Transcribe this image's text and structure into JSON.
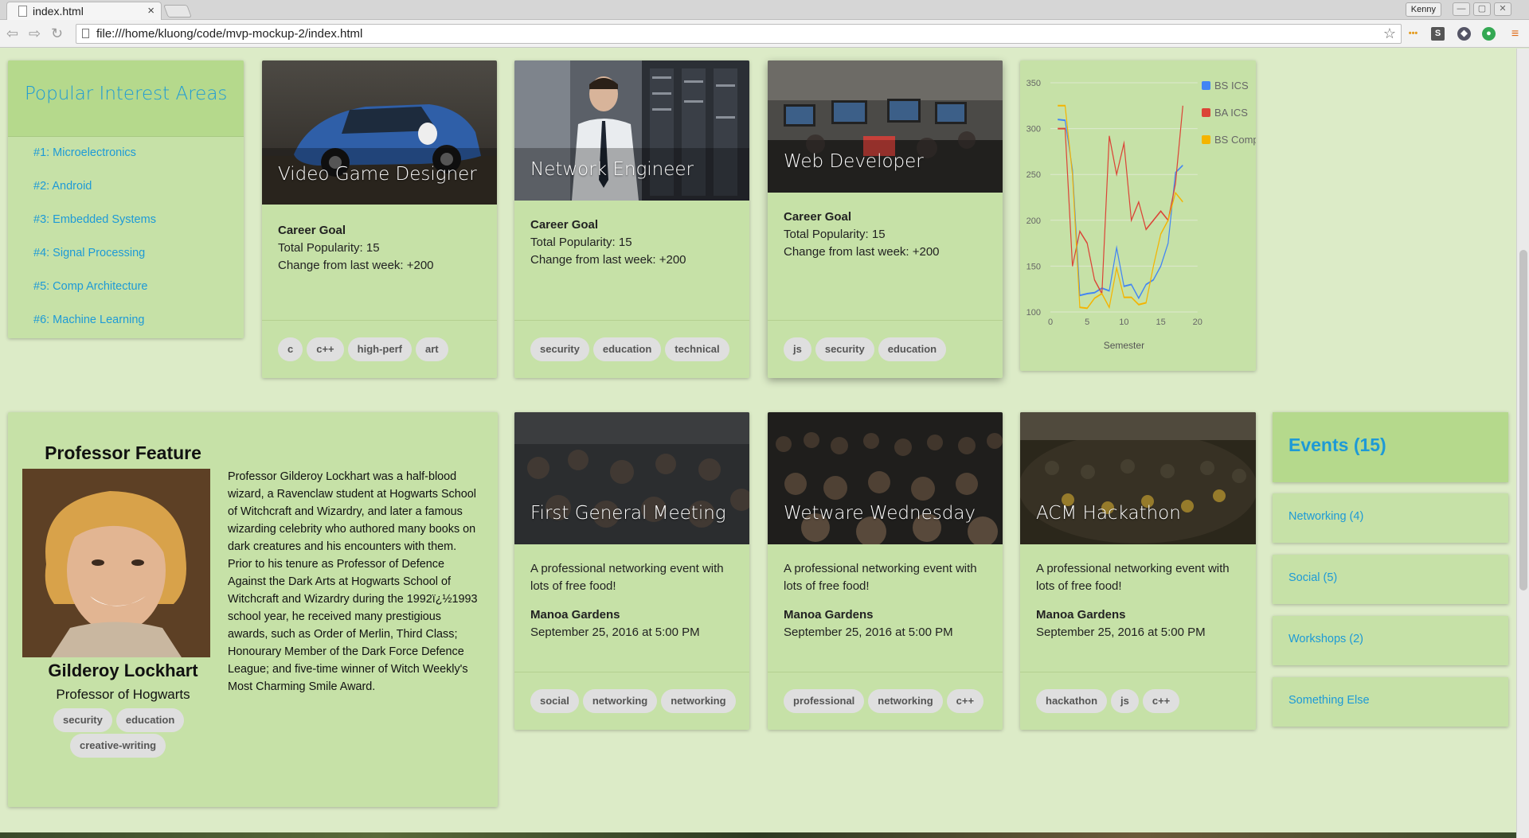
{
  "browser": {
    "tab_title": "index.html",
    "tab_close": "×",
    "user_badge": "Kenny",
    "url": "file:///home/kluong/code/mvp-mockup-2/index.html",
    "min": "—",
    "max": "▢",
    "close": "✕"
  },
  "interests": {
    "title": "Popular Interest Areas",
    "items": [
      "#1: Microelectronics",
      "#2: Android",
      "#3: Embedded Systems",
      "#4: Signal Processing",
      "#5: Comp Architecture",
      "#6: Machine Learning"
    ]
  },
  "careers": [
    {
      "title": "Video Game Designer",
      "goal": "Career Goal",
      "popularity": "Total Popularity: 15",
      "change": "Change from last week: +200",
      "tags": [
        "c",
        "c++",
        "high-perf",
        "art"
      ]
    },
    {
      "title": "Network Engineer",
      "goal": "Career Goal",
      "popularity": "Total Popularity: 15",
      "change": "Change from last week: +200",
      "tags": [
        "security",
        "education",
        "technical"
      ]
    },
    {
      "title": "Web Developer",
      "goal": "Career Goal",
      "popularity": "Total Popularity: 15",
      "change": "Change from last week: +200",
      "tags": [
        "js",
        "security",
        "education"
      ]
    }
  ],
  "chart_data": {
    "type": "line",
    "xlabel": "Semester",
    "ylabel": "",
    "xlim": [
      0,
      20
    ],
    "ylim": [
      100,
      350
    ],
    "x_ticks": [
      0,
      5,
      10,
      15,
      20
    ],
    "y_ticks": [
      100,
      150,
      200,
      250,
      300,
      350
    ],
    "grid": true,
    "legend_position": "top-right",
    "series": [
      {
        "name": "BS ICS",
        "color": "#4285f4",
        "x": [
          1,
          2,
          3,
          4,
          5,
          6,
          7,
          8,
          9,
          10,
          11,
          12,
          13,
          14,
          15,
          16,
          17,
          18
        ],
        "values": [
          310,
          309,
          255,
          118,
          120,
          121,
          126,
          123,
          170,
          128,
          130,
          115,
          130,
          135,
          150,
          175,
          252,
          260
        ]
      },
      {
        "name": "BA ICS",
        "color": "#db4437",
        "x": [
          1,
          2,
          3,
          4,
          5,
          6,
          7,
          8,
          9,
          10,
          11,
          12,
          13,
          14,
          15,
          16,
          17,
          18
        ],
        "values": [
          300,
          300,
          150,
          188,
          175,
          135,
          120,
          292,
          250,
          284,
          200,
          220,
          190,
          200,
          210,
          200,
          240,
          325
        ]
      },
      {
        "name": "BS CompE",
        "color": "#f4b400",
        "x": [
          1,
          2,
          3,
          4,
          5,
          6,
          7,
          8,
          9,
          10,
          11,
          12,
          13,
          14,
          15,
          16,
          17,
          18
        ],
        "values": [
          325,
          325,
          250,
          105,
          104,
          115,
          120,
          105,
          148,
          116,
          116,
          108,
          110,
          150,
          185,
          200,
          230,
          220
        ]
      }
    ]
  },
  "professor": {
    "section_title": "Professor Feature",
    "name": "Gilderoy Lockhart",
    "role": "Professor of Hogwarts",
    "tags": [
      "security",
      "education",
      "creative-writing"
    ],
    "bio1": "Professor Gilderoy Lockhart was a half-blood wizard, a Ravenclaw student at Hogwarts School of Witchcraft and Wizardry, and later a famous wizarding celebrity who authored many books on dark creatures and his encounters with them.",
    "bio2": "Prior to his tenure as Professor of Defence Against the Dark Arts at Hogwarts School of Witchcraft and Wizardry during the 1992ï¿½1993 school year, he received many prestigious awards, such as Order of Merlin, Third Class; Honourary Member of the Dark Force Defence League; and five-time winner of Witch Weekly's Most Charming Smile Award."
  },
  "events": [
    {
      "title": "First General Meeting",
      "desc": "A professional networking event with lots of free food!",
      "location": "Manoa Gardens",
      "date": "September 25, 2016 at 5:00 PM",
      "tags": [
        "social",
        "networking",
        "networking"
      ]
    },
    {
      "title": "Wetware Wednesday",
      "desc": "A professional networking event with lots of free food!",
      "location": "Manoa Gardens",
      "date": "September 25, 2016 at 5:00 PM",
      "tags": [
        "professional",
        "networking",
        "c++"
      ]
    },
    {
      "title": "ACM Hackathon",
      "desc": "A professional networking event with lots of free food!",
      "location": "Manoa Gardens",
      "date": "September 25, 2016 at 5:00 PM",
      "tags": [
        "hackathon",
        "js",
        "c++"
      ]
    }
  ],
  "events_panel": {
    "title": "Events (15)",
    "links": [
      "Networking (4)",
      "Social (5)",
      "Workshops (2)",
      "Something Else"
    ]
  },
  "colors": {
    "accent": "#1e9ad6",
    "card": "#c6e1a7",
    "page": "#dcebc7"
  }
}
